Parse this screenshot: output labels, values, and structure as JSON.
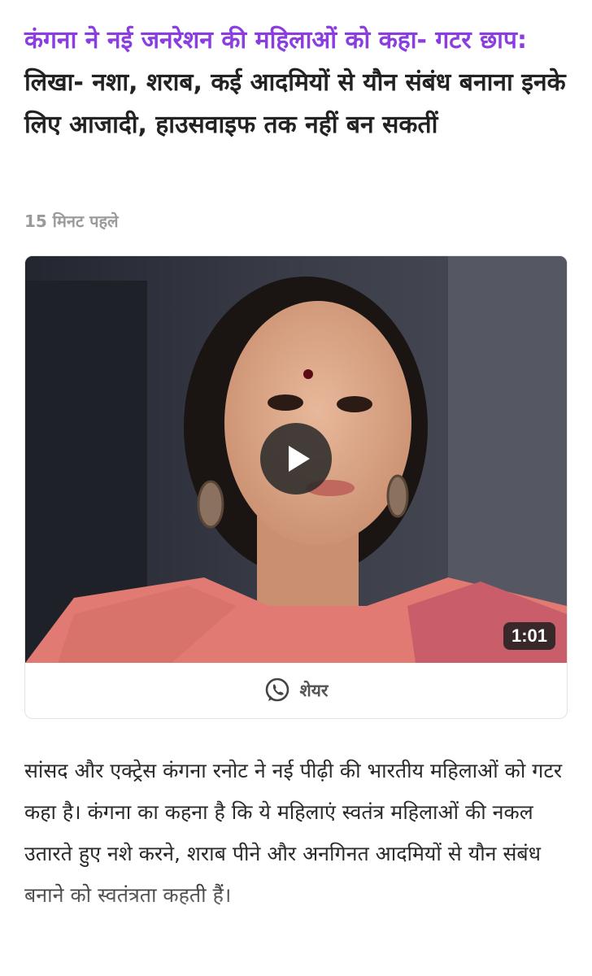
{
  "headline": {
    "lead": "कंगना ने नई जनरेशन की महिलाओं को कहा- गटर छाप:",
    "rest": " लिखा- नशा, शराब, कई आदमियों से यौन संबंध बनाना इनके लिए आजादी, हाउसवाइफ तक नहीं बन सकतीं"
  },
  "timestamp": "15 मिनट पहले",
  "video": {
    "duration": "1:01",
    "share_label": "शेयर",
    "play_icon": "play-icon",
    "share_icon": "whatsapp-icon"
  },
  "article": {
    "text": "सांसद और एक्ट्रेस कंगना रनोट ने नई पीढ़ी की भारतीय महिलाओं को गटर कहा है। कंगना का कहना है कि ये महिलाएं स्वतंत्र महिलाओं की नकल उतारते हुए नशे करने, शराब पीने और अनगिनत आदमियों से यौन संबंध बनाने को स्वतंत्रता कहती हैं।"
  },
  "colors": {
    "accent": "#8a3ee0",
    "timestamp": "#9a9a9a"
  }
}
